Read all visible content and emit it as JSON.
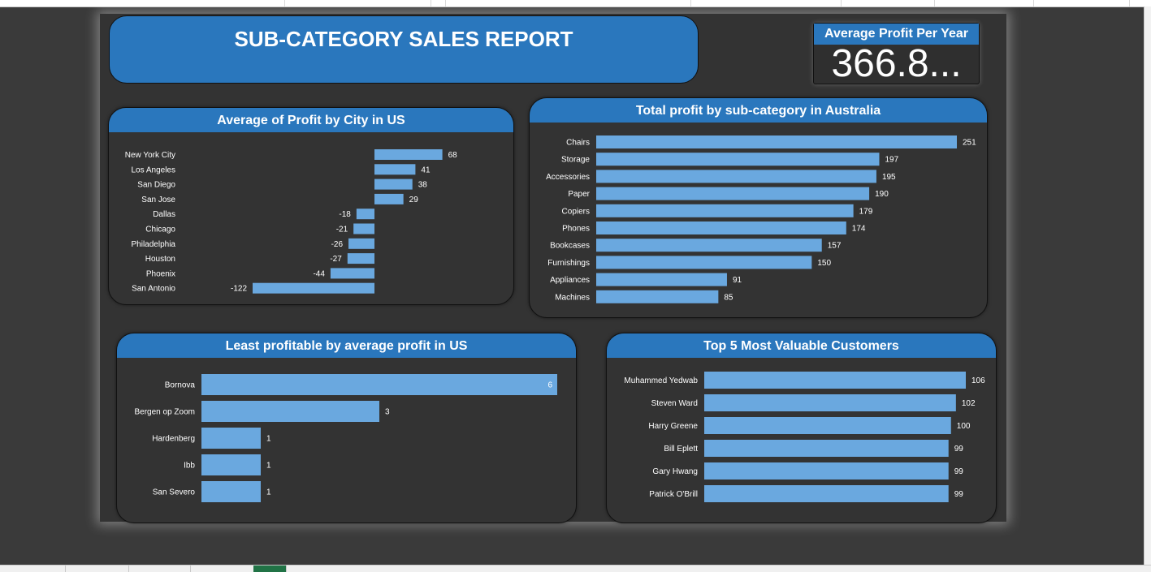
{
  "report_title": "SUB-CATEGORY SALES REPORT",
  "kpi": {
    "label": "Average Profit Per Year",
    "value": "366.8..."
  },
  "colors": {
    "header": "#2a77bd",
    "bar": "#6aa8df",
    "panel": "#333333",
    "text": "#ffffff"
  },
  "chart_data": [
    {
      "type": "bar",
      "orientation": "horizontal",
      "title": "Average of Profit by City in US",
      "categories": [
        "New York City",
        "Los Angeles",
        "San Diego",
        "San Jose",
        "Dallas",
        "Chicago",
        "Philadelphia",
        "Houston",
        "Phoenix",
        "San Antonio"
      ],
      "values": [
        68,
        41,
        38,
        29,
        -18,
        -21,
        -26,
        -27,
        -44,
        -122
      ],
      "xlim": [
        -122,
        68
      ]
    },
    {
      "type": "bar",
      "orientation": "horizontal",
      "title": "Total profit by sub-category in Australia",
      "categories": [
        "Chairs",
        "Storage",
        "Accessories",
        "Paper",
        "Copiers",
        "Phones",
        "Bookcases",
        "Furnishings",
        "Appliances",
        "Machines"
      ],
      "values": [
        251,
        197,
        195,
        190,
        179,
        174,
        157,
        150,
        91,
        85
      ],
      "xlim": [
        0,
        251
      ]
    },
    {
      "type": "bar",
      "orientation": "horizontal",
      "title": "Least profitable by average profit in US",
      "categories": [
        "Bornova",
        "Bergen op Zoom",
        "Hardenberg",
        "Ibb",
        "San Severo"
      ],
      "values": [
        6,
        3,
        1,
        1,
        1
      ],
      "xlim": [
        0,
        6
      ]
    },
    {
      "type": "bar",
      "orientation": "horizontal",
      "title": "Top 5 Most Valuable Customers",
      "categories": [
        "Muhammed Yedwab",
        "Steven Ward",
        "Harry Greene",
        "Bill Eplett",
        "Gary Hwang",
        "Patrick O'Brill"
      ],
      "values": [
        106,
        102,
        100,
        99,
        99,
        99
      ],
      "xlim": [
        0,
        106
      ]
    }
  ]
}
